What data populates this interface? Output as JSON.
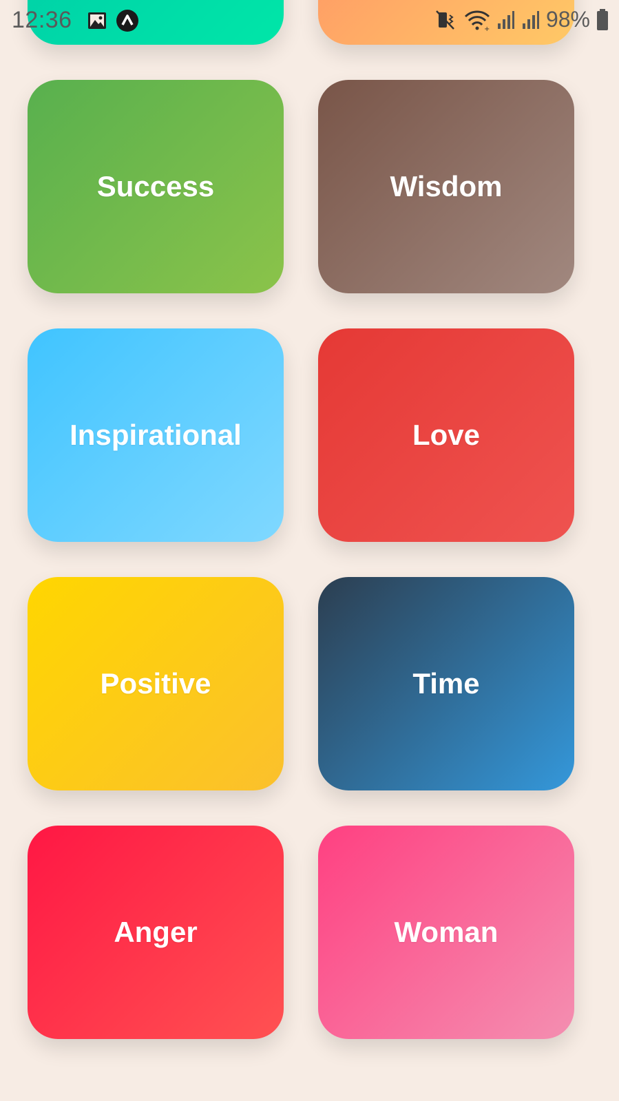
{
  "status_bar": {
    "time": "12:36",
    "battery": "98%",
    "icons_left": [
      "image-icon",
      "app-notification-icon"
    ],
    "icons_right": [
      "vibrate-icon",
      "wifi-icon",
      "signal-icon",
      "signal-icon-2",
      "battery-icon"
    ]
  },
  "categories": [
    {
      "label": "",
      "color": "#00d4a8"
    },
    {
      "label": "",
      "color": "#ffa866"
    },
    {
      "label": "Success",
      "color": "#6bb84c"
    },
    {
      "label": "Wisdom",
      "color": "#8d6e63"
    },
    {
      "label": "Inspirational",
      "color": "#5ecfff"
    },
    {
      "label": "Love",
      "color": "#e94441"
    },
    {
      "label": "Positive",
      "color": "#fdd015"
    },
    {
      "label": "Time",
      "color": "#2f6a97"
    },
    {
      "label": "Anger",
      "color": "#ff3049"
    },
    {
      "label": "Woman",
      "color": "#f96797"
    }
  ]
}
